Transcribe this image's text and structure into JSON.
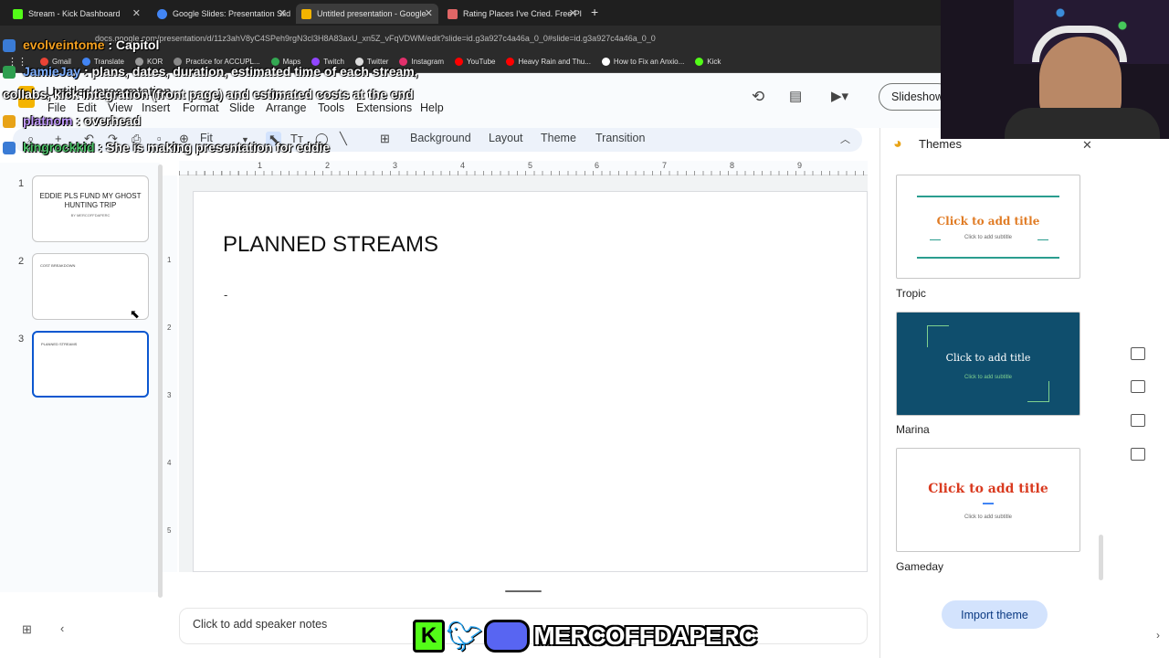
{
  "browser": {
    "tabs": [
      {
        "title": "Stream - Kick Dashboard",
        "color": "#53fc18",
        "active": false
      },
      {
        "title": "Google Slides: Presentation Slid",
        "color": "#4285f4",
        "active": false
      },
      {
        "title": "Untitled presentation - Google",
        "color": "#f4b400",
        "active": true
      },
      {
        "title": "Rating Places I've Cried. Free Pl",
        "color": "#e06666",
        "active": false
      }
    ],
    "new_tab": "+",
    "url": "docs.google.com/presentation/d/11z3ahV8yC4SPeh9rgN3cl3H8A83axU_xn5Z_vFqVDWM/edit?slide=id.g3a927c4a46a_0_0#slide=id.g3a927c4a46a_0_0",
    "bookmarks": [
      "Gmail",
      "Translate",
      "KOR",
      "Practice for ACCUPL...",
      "Maps",
      "Twitch",
      "Twitter",
      "Instagram",
      "YouTube",
      "Heavy Rain and Thu...",
      "How to Fix an Anxio...",
      "Kick"
    ]
  },
  "document": {
    "title": "Untitled presentation",
    "menu": [
      "File",
      "Edit",
      "View",
      "Insert",
      "Format",
      "Slide",
      "Arrange",
      "Tools",
      "Extensions",
      "Help"
    ],
    "slideshow_label": "Slideshow"
  },
  "toolbar": {
    "zoom": "Fit",
    "background": "Background",
    "layout": "Layout",
    "theme": "Theme",
    "transition": "Transition"
  },
  "ruler": [
    "1",
    "2",
    "3",
    "4",
    "5",
    "6",
    "7",
    "8",
    "9"
  ],
  "vruler": [
    "1",
    "2",
    "3",
    "4",
    "5"
  ],
  "filmstrip": {
    "slides": [
      {
        "num": "1",
        "title": "EDDIE PLS FUND MY GHOST HUNTING TRIP",
        "subtitle": "BY MERCOFFDAPERC"
      },
      {
        "num": "2",
        "title": "COST BREAKDOWN"
      },
      {
        "num": "3",
        "title": "PLANNED STREAMS"
      }
    ]
  },
  "slide": {
    "title": "PLANNED STREAMS",
    "body": "-"
  },
  "notes_placeholder": "Click to add speaker notes",
  "themes_panel": {
    "heading": "Themes",
    "themes": [
      {
        "name": "Tropic",
        "title": "Click to add title",
        "subtitle": "Click to add subtitle"
      },
      {
        "name": "Marina",
        "title": "Click to add title",
        "subtitle": "Click to add subtitle"
      },
      {
        "name": "Gameday",
        "title": "Click to add title",
        "subtitle": "Click to add subtitle"
      }
    ],
    "import_label": "Import theme"
  },
  "chat": [
    {
      "user": "evolveintome",
      "text": " : Capitol",
      "color": "#f4a020"
    },
    {
      "user": "JamieJay",
      "text": " : plans, dates, duration, estimated time of each stream,",
      "color": "#7fb0ff"
    },
    {
      "user": "",
      "text": "collabs, kick integration (front page) and estimated costs at the end",
      "color": "#fff"
    },
    {
      "user": "platnom",
      "text": " : overhead",
      "color": "#c39bff"
    },
    {
      "user": "kingrockkid",
      "text": " : She is making presentation for eddie",
      "color": "#4ec26a"
    }
  ],
  "banner": {
    "kick_letter": "K",
    "name": "MERCOFFDAPERC"
  },
  "colors": {
    "accent": "#0b57d0",
    "tropic_title": "#e07b24",
    "marina_bg": "#0f4e6d",
    "gameday_title": "#d93a1f"
  }
}
